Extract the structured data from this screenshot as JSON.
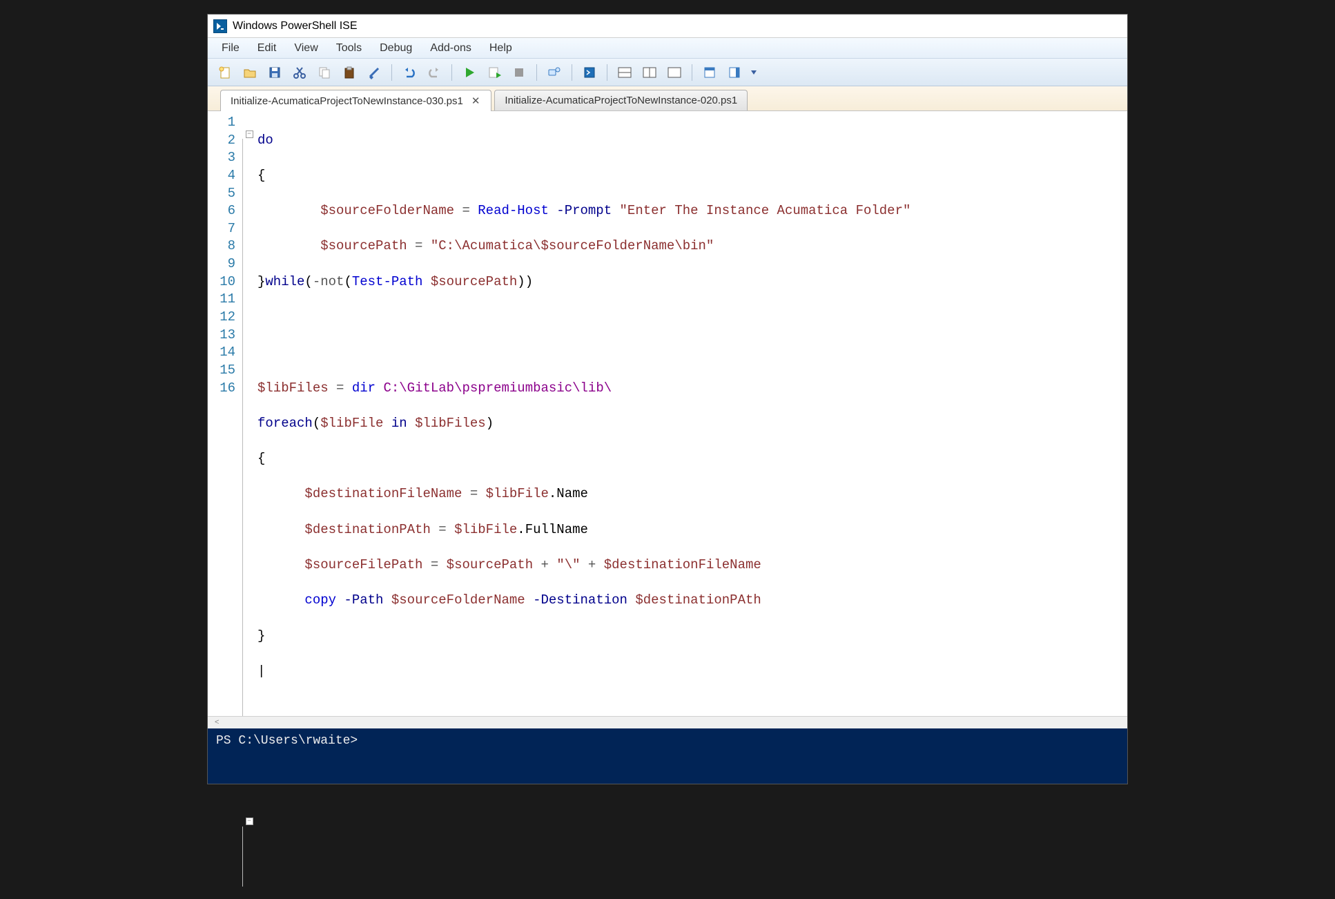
{
  "title": "Windows PowerShell ISE",
  "menus": [
    "File",
    "Edit",
    "View",
    "Tools",
    "Debug",
    "Add-ons",
    "Help"
  ],
  "tabs": [
    {
      "label": "Initialize-AcumaticaProjectToNewInstance-030.ps1",
      "active": true,
      "closable": true
    },
    {
      "label": "Initialize-AcumaticaProjectToNewInstance-020.ps1",
      "active": false,
      "closable": false
    }
  ],
  "toolbar_icons": [
    "new-file",
    "open-file",
    "save-file",
    "cut",
    "copy",
    "paste",
    "run-selection",
    "undo",
    "redo",
    "run-script",
    "run-line",
    "stop",
    "remote",
    "powershell-console",
    "layout-split",
    "layout-tile",
    "layout-maximize",
    "show-script",
    "show-command",
    "toolbox-dropdown"
  ],
  "line_numbers": [
    "1",
    "2",
    "3",
    "4",
    "5",
    "6",
    "7",
    "8",
    "9",
    "10",
    "11",
    "12",
    "13",
    "14",
    "15",
    "16"
  ],
  "fold_markers": {
    "2": "–",
    "10": "–"
  },
  "code": {
    "l1": {
      "a": "do"
    },
    "l2": {
      "a": "{"
    },
    "l3": {
      "a": "        $sourceFolderName",
      "b": " = ",
      "c": "Read-Host",
      "d": " -Prompt ",
      "e": "\"Enter The Instance Acumatica Folder\""
    },
    "l4": {
      "a": "        $sourcePath",
      "b": " = ",
      "c": "\"C:\\Acumatica\\$sourceFolderName\\bin\""
    },
    "l5": {
      "a": "}",
      "b": "while",
      "c": "(",
      "d": "-not",
      "e": "(",
      "f": "Test-Path",
      "g": " $sourcePath",
      "h": "))"
    },
    "l6": {
      "a": ""
    },
    "l7": {
      "a": ""
    },
    "l8": {
      "a": "$libFiles",
      "b": " = ",
      "c": "dir",
      "d": " C:\\GitLab\\pspremiumbasic\\lib\\"
    },
    "l9": {
      "a": "foreach",
      "b": "(",
      "c": "$libFile",
      "d": " in ",
      "e": "$libFiles",
      "f": ")"
    },
    "l10": {
      "a": "{"
    },
    "l11": {
      "a": "      $destinationFileName",
      "b": " = ",
      "c": "$libFile",
      "d": ".",
      "e": "Name"
    },
    "l12": {
      "a": "      $destinationPAth",
      "b": " = ",
      "c": "$libFile",
      "d": ".",
      "e": "FullName"
    },
    "l13": {
      "a": "      $sourceFilePath",
      "b": " = ",
      "c": "$sourcePath",
      "d": " + ",
      "e": "\"\\\"",
      "f": " + ",
      "g": "$destinationFileName"
    },
    "l14": {
      "a": "      ",
      "b": "copy",
      "c": " -Path ",
      "d": "$sourceFolderName",
      "e": " -Destination ",
      "f": "$destinationPAth"
    },
    "l15": {
      "a": "}"
    },
    "l16": {
      "a": "|"
    }
  },
  "console_prompt": "PS C:\\Users\\rwaite> ",
  "statusbar_hint": "<"
}
